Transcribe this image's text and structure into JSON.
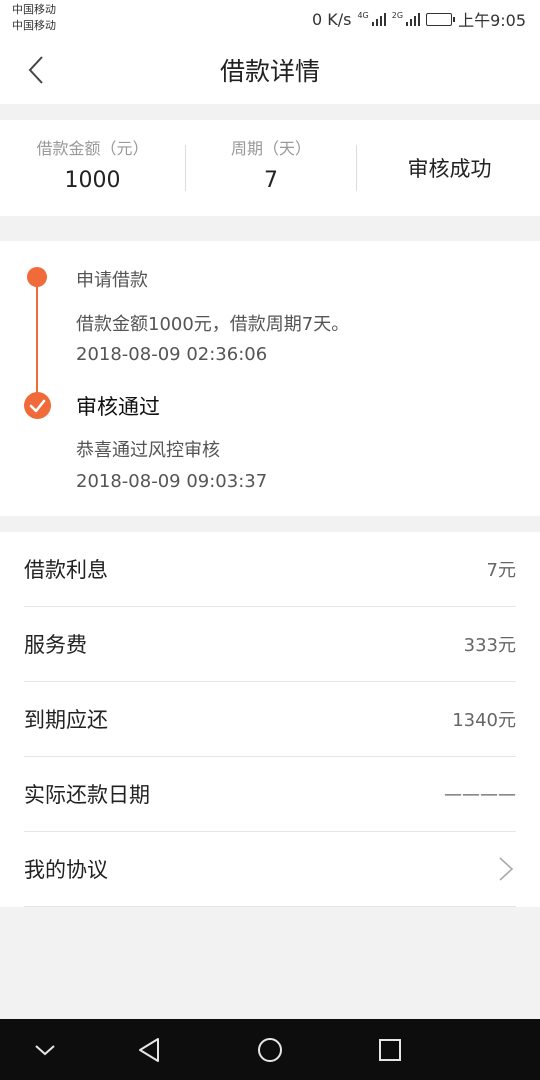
{
  "status_bar": {
    "carrier_1": "中国移动",
    "carrier_2": "中国移动",
    "speed": "0 K/s",
    "net_1": "4G",
    "net_2": "2G",
    "time": "上午9:05",
    "battery_icon": "battery-full-icon"
  },
  "nav": {
    "title": "借款详情",
    "back_icon": "back-chevron-icon"
  },
  "summary": {
    "amount_label": "借款金额（元）",
    "amount_value": "1000",
    "period_label": "周期（天）",
    "period_value": "7",
    "status": "审核成功"
  },
  "timeline": {
    "accent_color": "#f06a3a",
    "steps": [
      {
        "title": "申请借款",
        "desc": "借款金额1000元，借款周期7天。",
        "time": "2018-08-09 02:36:06"
      },
      {
        "title": "审核通过",
        "desc": "恭喜通过风控审核",
        "time": "2018-08-09 09:03:37"
      }
    ]
  },
  "details": {
    "rows": [
      {
        "label": "借款利息",
        "value": "7元"
      },
      {
        "label": "服务费",
        "value": "333元"
      },
      {
        "label": "到期应还",
        "value": "1340元"
      },
      {
        "label": "实际还款日期",
        "value": "————"
      },
      {
        "label": "我的协议",
        "value": ""
      }
    ],
    "chevron_icon": "chevron-right-icon"
  },
  "system_nav": {
    "icons": [
      "collapse-down-icon",
      "back-triangle-icon",
      "home-circle-icon",
      "recents-square-icon"
    ]
  }
}
